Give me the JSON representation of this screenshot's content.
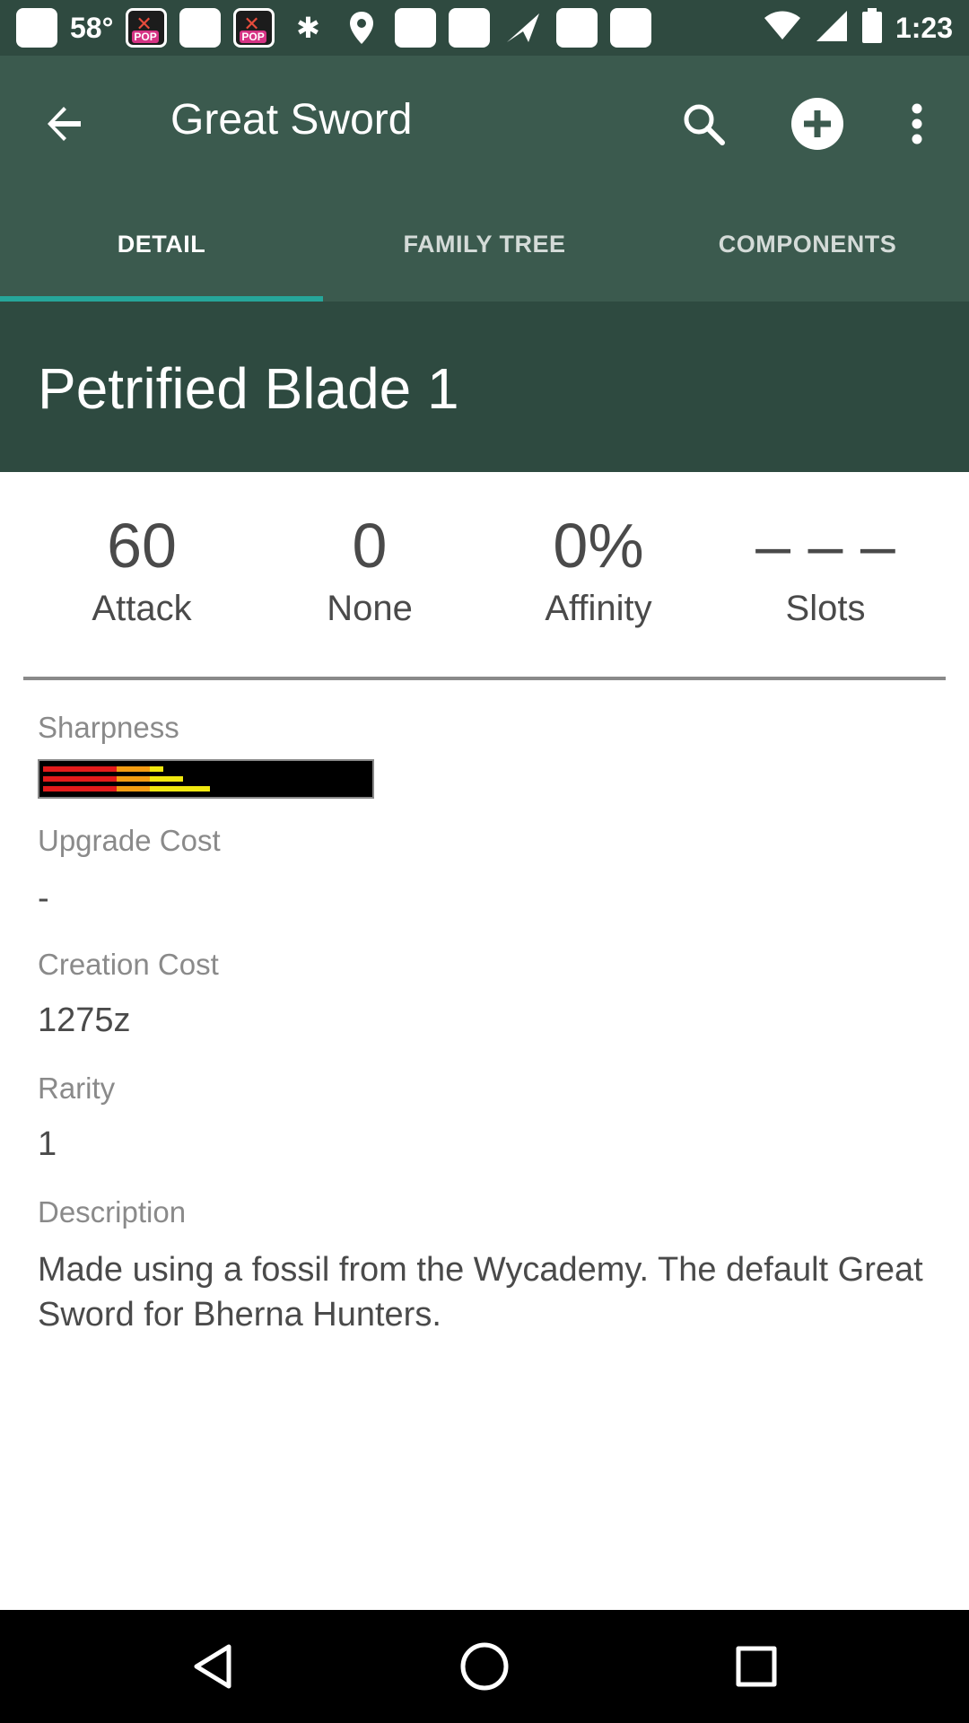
{
  "status_bar": {
    "temperature": "58°",
    "time": "1:23",
    "notification_icons": [
      "message-icon",
      "pop-app-icon",
      "square-icon",
      "pop-app-icon",
      "gymnast-icon",
      "location-pin-icon",
      "square-icon",
      "square-icon",
      "send-icon",
      "square-icon",
      "square-icon"
    ]
  },
  "app_bar": {
    "title": "Great Sword",
    "actions": [
      "search-icon",
      "add-circle-icon",
      "more-vertical-icon"
    ]
  },
  "tabs": [
    {
      "label": "DETAIL",
      "active": true
    },
    {
      "label": "FAMILY TREE",
      "active": false
    },
    {
      "label": "COMPONENTS",
      "active": false
    }
  ],
  "weapon": {
    "name": "Petrified Blade 1"
  },
  "stats": [
    {
      "value": "60",
      "label": "Attack"
    },
    {
      "value": "0",
      "label": "None"
    },
    {
      "value": "0%",
      "label": "Affinity"
    },
    {
      "value": "– – –",
      "label": "Slots"
    }
  ],
  "details": {
    "sharpness_label": "Sharpness",
    "sharpness": {
      "rows": [
        [
          {
            "color": "#e31b1b",
            "fraction": 0.22
          },
          {
            "color": "#f39c12",
            "fraction": 0.1
          },
          {
            "color": "#f1e80f",
            "fraction": 0.04
          }
        ],
        [
          {
            "color": "#e31b1b",
            "fraction": 0.22
          },
          {
            "color": "#f39c12",
            "fraction": 0.1
          },
          {
            "color": "#f1e80f",
            "fraction": 0.1
          }
        ],
        [
          {
            "color": "#e31b1b",
            "fraction": 0.22
          },
          {
            "color": "#f39c12",
            "fraction": 0.1
          },
          {
            "color": "#f1e80f",
            "fraction": 0.18
          }
        ]
      ]
    },
    "upgrade_cost_label": "Upgrade Cost",
    "upgrade_cost": "-",
    "creation_cost_label": "Creation Cost",
    "creation_cost": "1275z",
    "rarity_label": "Rarity",
    "rarity": "1",
    "description_label": "Description",
    "description": "Made using a fossil from the Wycademy. The default Great Sword for Bherna Hunters."
  },
  "nav_bar": {
    "buttons": [
      "back-triangle-icon",
      "home-circle-icon",
      "recents-square-icon"
    ]
  },
  "colors": {
    "app_bar": "#3b5a4e",
    "header_band": "#2e4a40",
    "tab_indicator": "#26a69a"
  }
}
